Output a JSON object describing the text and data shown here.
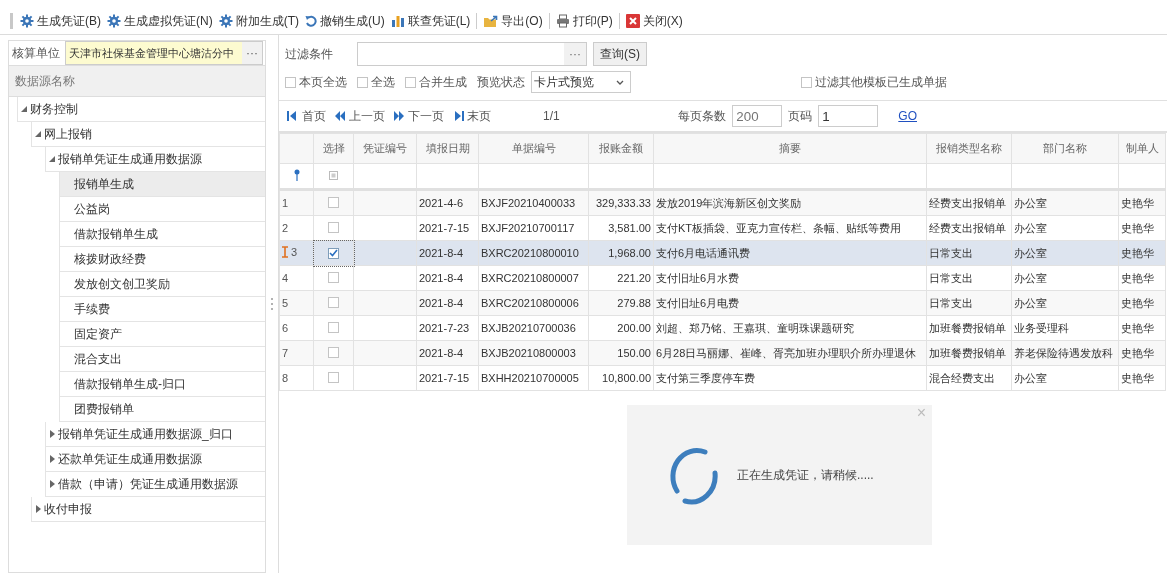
{
  "toolbar": [
    {
      "label": "生成凭证(B)",
      "kind": "gear"
    },
    {
      "label": "生成虚拟凭证(N)",
      "kind": "gear"
    },
    {
      "label": "附加生成(T)",
      "kind": "gear"
    },
    {
      "label": "撤销生成(U)",
      "kind": "undo"
    },
    {
      "label": "联查凭证(L)",
      "kind": "chart"
    },
    {
      "label": "导出(O)",
      "kind": "export"
    },
    {
      "label": "打印(P)",
      "kind": "print"
    },
    {
      "label": "关闭(X)",
      "kind": "close"
    }
  ],
  "unit": {
    "label": "核算单位",
    "value": "天津市社保基金管理中心塘沽分中",
    "button": "···"
  },
  "tree": {
    "header": "数据源名称",
    "items": [
      {
        "label": "财务控制",
        "expanded": true,
        "selected": false,
        "children": [
          {
            "label": "网上报销",
            "expanded": true,
            "selected": false,
            "children": [
              {
                "label": "报销单凭证生成通用数据源",
                "expanded": true,
                "selected": false,
                "children": [
                  {
                    "label": "报销单生成",
                    "selected": true
                  },
                  {
                    "label": "公益岗",
                    "selected": false
                  },
                  {
                    "label": "借款报销单生成",
                    "selected": false
                  },
                  {
                    "label": "核拨财政经费",
                    "selected": false
                  },
                  {
                    "label": "发放创文创卫奖励",
                    "selected": false
                  },
                  {
                    "label": "手续费",
                    "selected": false
                  },
                  {
                    "label": "固定资产",
                    "selected": false
                  },
                  {
                    "label": "混合支出",
                    "selected": false
                  },
                  {
                    "label": "借款报销单生成-归口",
                    "selected": false
                  },
                  {
                    "label": "团费报销单",
                    "selected": false
                  }
                ]
              },
              {
                "label": "报销单凭证生成通用数据源_归口",
                "expanded": false,
                "selected": false
              },
              {
                "label": "还款单凭证生成通用数据源",
                "expanded": false,
                "selected": false
              },
              {
                "label": "借款（申请）凭证生成通用数据源",
                "expanded": false,
                "selected": false
              }
            ]
          },
          {
            "label": "收付申报",
            "expanded": false,
            "selected": false
          }
        ]
      }
    ]
  },
  "filter": {
    "label": "过滤条件",
    "button": "···",
    "query": "查询(S)",
    "options": [
      {
        "label": "本页全选",
        "checked": false
      },
      {
        "label": "全选",
        "checked": false
      },
      {
        "label": "合并生成",
        "checked": false
      }
    ],
    "preview_label": "预览状态",
    "preview_value": "卡片式预览",
    "other": {
      "label": "过滤其他模板已生成单据",
      "checked": false
    }
  },
  "pager": {
    "nav": [
      {
        "label": "首页",
        "kind": "first"
      },
      {
        "label": "上一页",
        "kind": "prev"
      },
      {
        "label": "下一页",
        "kind": "next"
      },
      {
        "label": "末页",
        "kind": "last"
      }
    ],
    "page_info": "1/1",
    "size_label": "每页条数",
    "size_placeholder": "200",
    "page_label": "页码",
    "page_value": "1",
    "go": "GO"
  },
  "table": {
    "columns": [
      "选择",
      "凭证编号",
      "填报日期",
      "单据编号",
      "报账金额",
      "摘要",
      "报销类型名称",
      "部门名称",
      "制单人"
    ],
    "rows": [
      {
        "no": "1",
        "checked": false,
        "selected": false,
        "date": "2021-4-6",
        "bill": "BXJF20210400033",
        "amount": "329,333.33",
        "summary": "发放2019年滨海新区创文奖励",
        "type": "经费支出报销单",
        "dept": "办公室",
        "maker": "史艳华"
      },
      {
        "no": "2",
        "checked": false,
        "selected": false,
        "date": "2021-7-15",
        "bill": "BXJF20210700117",
        "amount": "3,581.00",
        "summary": "支付KT板插袋、亚克力宣传栏、条幅、贴纸等费用",
        "type": "经费支出报销单",
        "dept": "办公室",
        "maker": "史艳华"
      },
      {
        "no": "3",
        "checked": true,
        "selected": true,
        "date": "2021-8-4",
        "bill": "BXRC20210800010",
        "amount": "1,968.00",
        "summary": "支付6月电话通讯费",
        "type": "日常支出",
        "dept": "办公室",
        "maker": "史艳华"
      },
      {
        "no": "4",
        "checked": false,
        "selected": false,
        "date": "2021-8-4",
        "bill": "BXRC20210800007",
        "amount": "221.20",
        "summary": "支付旧址6月水费",
        "type": "日常支出",
        "dept": "办公室",
        "maker": "史艳华"
      },
      {
        "no": "5",
        "checked": false,
        "selected": false,
        "date": "2021-8-4",
        "bill": "BXRC20210800006",
        "amount": "279.88",
        "summary": "支付旧址6月电费",
        "type": "日常支出",
        "dept": "办公室",
        "maker": "史艳华"
      },
      {
        "no": "6",
        "checked": false,
        "selected": false,
        "date": "2021-7-23",
        "bill": "BXJB20210700036",
        "amount": "200.00",
        "summary": "刘超、郑乃铭、王嘉琪、童明珠课题研究",
        "type": "加班餐费报销单",
        "dept": "业务受理科",
        "maker": "史艳华"
      },
      {
        "no": "7",
        "checked": false,
        "selected": false,
        "date": "2021-8-4",
        "bill": "BXJB20210800003",
        "amount": "150.00",
        "summary": "6月28日马丽娜、崔峰、胥亮加班办理职介所办理退休",
        "type": "加班餐费报销单",
        "dept": "养老保险待遇发放科",
        "maker": "史艳华"
      },
      {
        "no": "8",
        "checked": false,
        "selected": false,
        "date": "2021-7-15",
        "bill": "BXHH20210700005",
        "amount": "10,800.00",
        "summary": "支付第三季度停车费",
        "type": "混合经费支出",
        "dept": "办公室",
        "maker": "史艳华"
      }
    ]
  },
  "dialog": {
    "message": "正在生成凭证，请稍候.....",
    "close": "×"
  }
}
